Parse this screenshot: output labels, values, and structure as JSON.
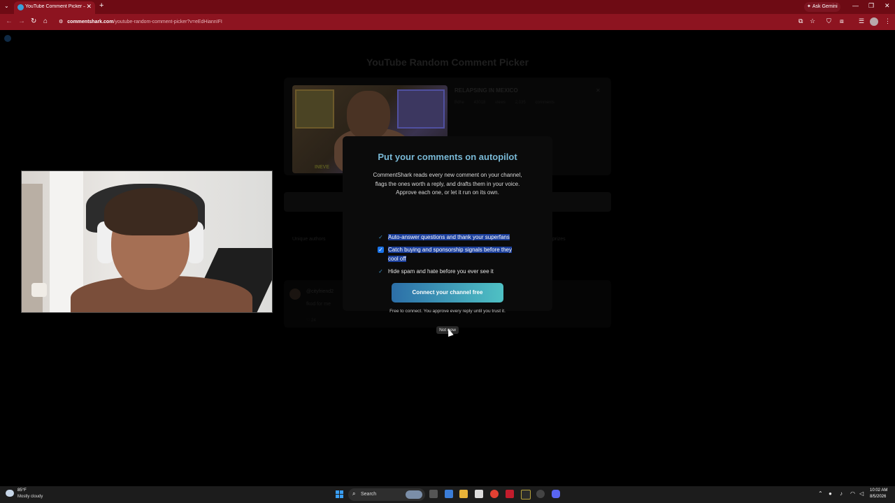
{
  "browser": {
    "tab_title": "YouTube Comment Picker — R",
    "tab_close": "✕",
    "tab_list_icon": "⌄",
    "new_tab": "+",
    "ask_gemini": "Ask Gemini",
    "url_host": "commentshark.com",
    "url_path": "/youtube-random-comment-picker?v=eEdHiannIFI",
    "accent": "#8d1420"
  },
  "background_page": {
    "title": "YouTube Random Comment Picker",
    "video_title": "RELAPSING IN MEXICO",
    "video_meta": "Bdhe  43018 views  2,035 comments",
    "thumb_label": "INEVE",
    "filter_left": "Unique authors",
    "filter_right": "prizes",
    "comment_author": "@cityfriend2",
    "comment_text": "fkod for me",
    "comment_likes": "♡ 24"
  },
  "modal": {
    "title": "Put your comments on autopilot",
    "description": "CommentShark reads every new comment on your channel, flags the ones worth a reply, and drafts them in your voice. Approve each one, or let it run on its own.",
    "features": [
      {
        "label": "Auto-answer questions and thank your superfans",
        "checked": true
      },
      {
        "label": "Catch buying and sponsorship signals before they cool off",
        "checked": true
      },
      {
        "label": "Hide spam and hate before you ever see it",
        "checked": true
      }
    ],
    "cta": "Connect your channel free",
    "note": "Free to connect. You approve every reply until you trust it.",
    "dismiss": "Not now",
    "title_color": "#79b9d6"
  },
  "taskbar": {
    "weather_temp": "85°F",
    "weather_desc": "Mostly cloudy",
    "search_label": "Search",
    "time": "10:02 AM",
    "date": "8/5/2026"
  }
}
